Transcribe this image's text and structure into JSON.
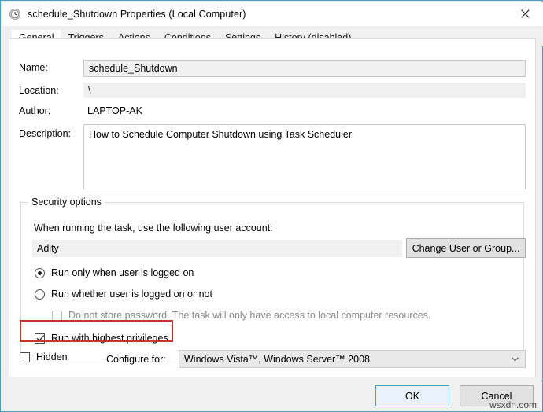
{
  "window": {
    "title": "schedule_Shutdown Properties (Local Computer)",
    "icon": "task-clock-icon",
    "close_label": "Close",
    "accent_color": "#4a9cc7"
  },
  "tabs": [
    {
      "label": "General",
      "active": true
    },
    {
      "label": "Triggers",
      "active": false
    },
    {
      "label": "Actions",
      "active": false
    },
    {
      "label": "Conditions",
      "active": false
    },
    {
      "label": "Settings",
      "active": false
    },
    {
      "label": "History (disabled)",
      "active": false
    }
  ],
  "general": {
    "name_label": "Name:",
    "name_value": "schedule_Shutdown",
    "location_label": "Location:",
    "location_value": "\\",
    "author_label": "Author:",
    "author_value": "LAPTOP-AK",
    "description_label": "Description:",
    "description_value": "How to Schedule Computer Shutdown using Task Scheduler"
  },
  "security": {
    "group_title": "Security options",
    "account_prompt": "When running the task, use the following user account:",
    "account_value": "Adity",
    "change_user_button": "Change User or Group...",
    "radio_logged_on": "Run only when user is logged on",
    "radio_logged_on_checked": true,
    "radio_whether": "Run whether user is logged on or not",
    "radio_whether_checked": false,
    "checkbox_no_password": "Do not store password.  The task will only have access to local computer resources.",
    "checkbox_no_password_checked": false,
    "checkbox_no_password_disabled": true,
    "checkbox_highest": "Run with highest privileges",
    "checkbox_highest_checked": true,
    "highlight_color": "#c0392b"
  },
  "bottom": {
    "hidden_label": "Hidden",
    "hidden_checked": false,
    "configure_label": "Configure for:",
    "configure_value": "Windows Vista™, Windows Server™ 2008"
  },
  "footer": {
    "ok_label": "OK",
    "cancel_label": "Cancel"
  },
  "watermark": {
    "text": "wsxdn.com"
  }
}
